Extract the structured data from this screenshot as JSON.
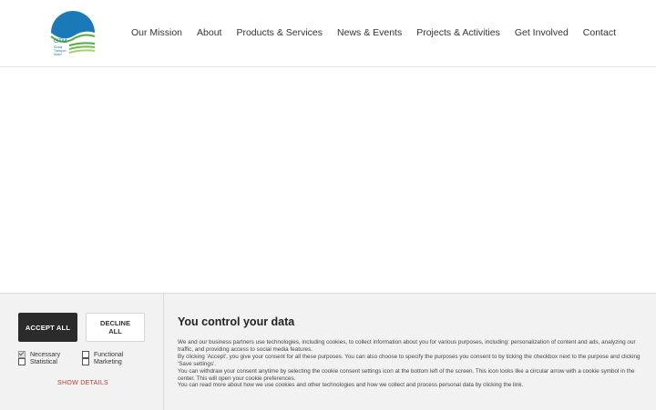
{
  "logo": {
    "text": "GTM",
    "tagline": "Global Transport Model"
  },
  "nav": [
    "Our Mission",
    "About",
    "Products & Services",
    "News & Events",
    "Projects & Activities",
    "Get Involved",
    "Contact"
  ],
  "consent": {
    "accept_label": "ACCEPT ALL",
    "decline_label": "DECLINE ALL",
    "checkboxes": [
      {
        "label": "Necessary",
        "checked": true
      },
      {
        "label": "Functional",
        "checked": false
      },
      {
        "label": "Statistical",
        "checked": false
      },
      {
        "label": "Marketing",
        "checked": false
      }
    ],
    "show_details_label": "SHOW DETAILS",
    "title": "You control your data",
    "paragraphs": [
      "We and our business partners use technologies, including cookies, to collect information about you for various purposes, including: personalization of content and ads, analyzing our traffic, and providing access to social media features.",
      "By clicking 'Accept', you give your consent for all these purposes. You can also choose to specify the purposes you consent to by ticking the checkbox next to the purpose and clicking 'Save settings'.",
      "You can withdraw your consent anytime by selecting the cookie consent settings icon at the bottom left of the screen. This icon looks like a circular arrow with a cookie symbol in the center. This will open your cookie preferences.",
      "You can read more about how we use cookies and other technologies and how we collect and process personal data by clicking the link."
    ]
  },
  "colors": {
    "logo_blue": "#1b79b8",
    "logo_green": "#4fae3b",
    "accept_bg": "#2b2b2b",
    "link_red": "#b23a3a"
  }
}
